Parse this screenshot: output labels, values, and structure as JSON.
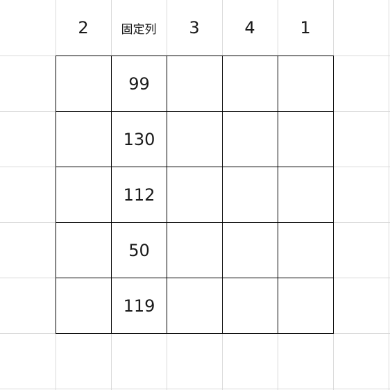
{
  "header": {
    "cells": [
      "2",
      "固定列",
      "3",
      "4",
      "1"
    ]
  },
  "table": {
    "fixed_column_values": [
      "99",
      "130",
      "112",
      "50",
      "119"
    ]
  }
}
